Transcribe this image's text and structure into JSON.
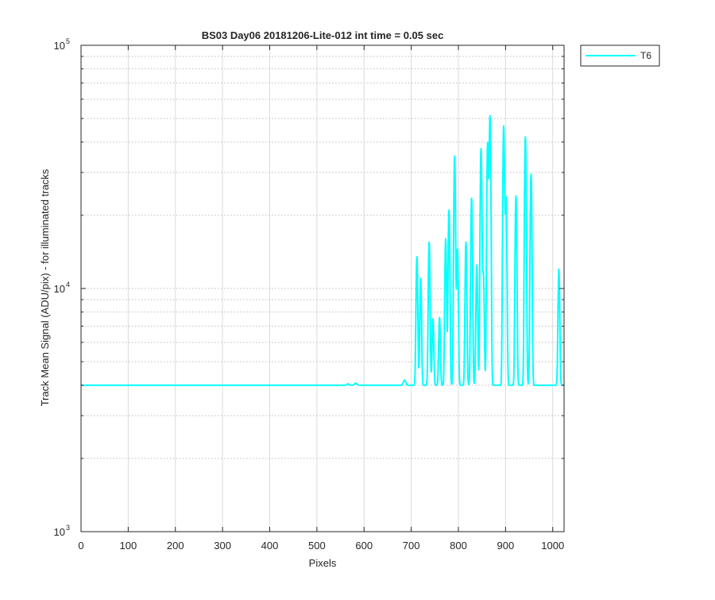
{
  "chart_data": {
    "type": "line",
    "title": "BS03 Day06 20181206-Lite-012 int time = 0.05 sec",
    "xlabel": "Pixels",
    "ylabel": "Track Mean Signal (ADU/pix) - for illuminated tracks",
    "xlim": [
      0,
      1024
    ],
    "ylim": [
      1000,
      100000
    ],
    "yscale": "log",
    "grid": true,
    "x_ticks": [
      0,
      100,
      200,
      300,
      400,
      500,
      600,
      700,
      800,
      900,
      1000
    ],
    "y_ticks": [
      {
        "base": "10",
        "exp": "3",
        "value": 1000
      },
      {
        "base": "10",
        "exp": "4",
        "value": 10000
      },
      {
        "base": "10",
        "exp": "5",
        "value": 100000
      }
    ],
    "legend": {
      "position": "outside-top-right",
      "entries": [
        "T6"
      ]
    },
    "series": [
      {
        "name": "T6",
        "color": "#00ffff",
        "baseline": 4000,
        "points": [
          [
            0,
            4000
          ],
          [
            560,
            4000
          ],
          [
            1024,
            4000
          ]
        ],
        "peaks": [
          {
            "x": 566,
            "y": 4050,
            "w": 2.5
          },
          {
            "x": 582,
            "y": 4080,
            "w": 2.5
          },
          {
            "x": 686,
            "y": 4200,
            "w": 2.5
          },
          {
            "x": 712,
            "y": 13500,
            "w": 1.6
          },
          {
            "x": 720,
            "y": 11000,
            "w": 1.6
          },
          {
            "x": 738,
            "y": 15500,
            "w": 1.6
          },
          {
            "x": 746,
            "y": 7500,
            "w": 1.6
          },
          {
            "x": 760,
            "y": 7600,
            "w": 1.6
          },
          {
            "x": 773,
            "y": 16000,
            "w": 1.6
          },
          {
            "x": 780,
            "y": 21000,
            "w": 1.6
          },
          {
            "x": 792,
            "y": 35000,
            "w": 1.6
          },
          {
            "x": 798,
            "y": 14500,
            "w": 1.6
          },
          {
            "x": 816,
            "y": 15500,
            "w": 1.6
          },
          {
            "x": 828,
            "y": 23500,
            "w": 1.6
          },
          {
            "x": 839,
            "y": 12500,
            "w": 1.6
          },
          {
            "x": 848,
            "y": 37500,
            "w": 1.6
          },
          {
            "x": 853,
            "y": 11500,
            "w": 1.6
          },
          {
            "x": 862,
            "y": 39500,
            "w": 1.6
          },
          {
            "x": 867,
            "y": 51000,
            "w": 1.6
          },
          {
            "x": 896,
            "y": 46500,
            "w": 1.6
          },
          {
            "x": 901,
            "y": 23500,
            "w": 1.6
          },
          {
            "x": 922,
            "y": 24000,
            "w": 1.6
          },
          {
            "x": 942,
            "y": 42000,
            "w": 1.6
          },
          {
            "x": 954,
            "y": 29500,
            "w": 1.6
          },
          {
            "x": 1013,
            "y": 12000,
            "w": 1.6
          }
        ]
      }
    ]
  }
}
